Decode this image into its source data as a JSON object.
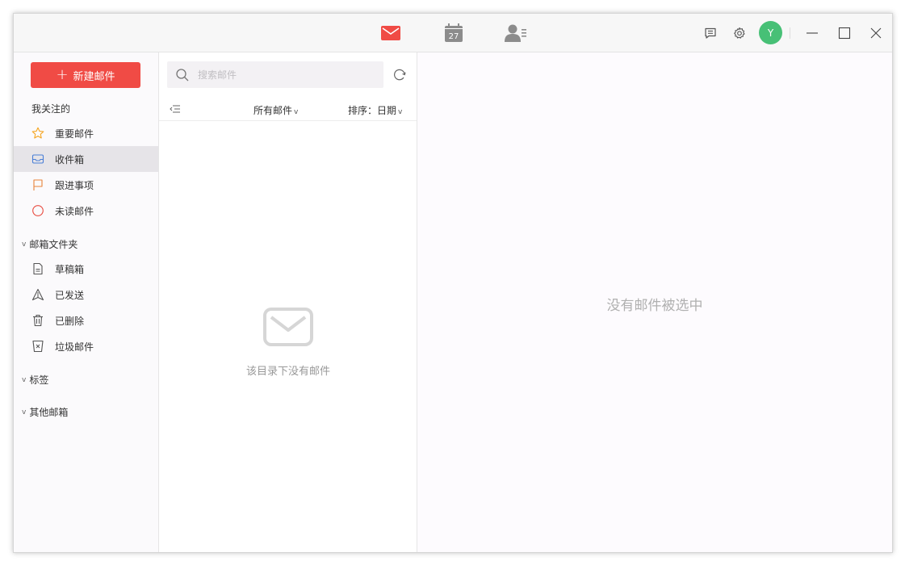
{
  "titlebar": {
    "calendar_day": "27",
    "avatar_initial": "Y",
    "accent_color": "#f04b45",
    "avatar_color": "#47c076"
  },
  "sidebar": {
    "compose_label": "新建邮件",
    "favorites_title": "我关注的",
    "favorites": [
      {
        "label": "重要邮件",
        "icon": "star-icon"
      },
      {
        "label": "收件箱",
        "icon": "inbox-icon"
      },
      {
        "label": "跟进事项",
        "icon": "flag-icon"
      },
      {
        "label": "未读邮件",
        "icon": "circle-icon"
      }
    ],
    "folders_title": "邮箱文件夹",
    "folders": [
      {
        "label": "草稿箱",
        "icon": "draft-icon"
      },
      {
        "label": "已发送",
        "icon": "sent-icon"
      },
      {
        "label": "已删除",
        "icon": "trash-icon"
      },
      {
        "label": "垃圾邮件",
        "icon": "spam-icon"
      }
    ],
    "tags_title": "标签",
    "other_title": "其他邮箱",
    "selected": "收件箱"
  },
  "list": {
    "search_placeholder": "搜索邮件",
    "filter_label": "所有邮件",
    "sort_label": "排序：日期",
    "empty_text": "该目录下没有邮件"
  },
  "reading": {
    "empty_text": "没有邮件被选中"
  }
}
